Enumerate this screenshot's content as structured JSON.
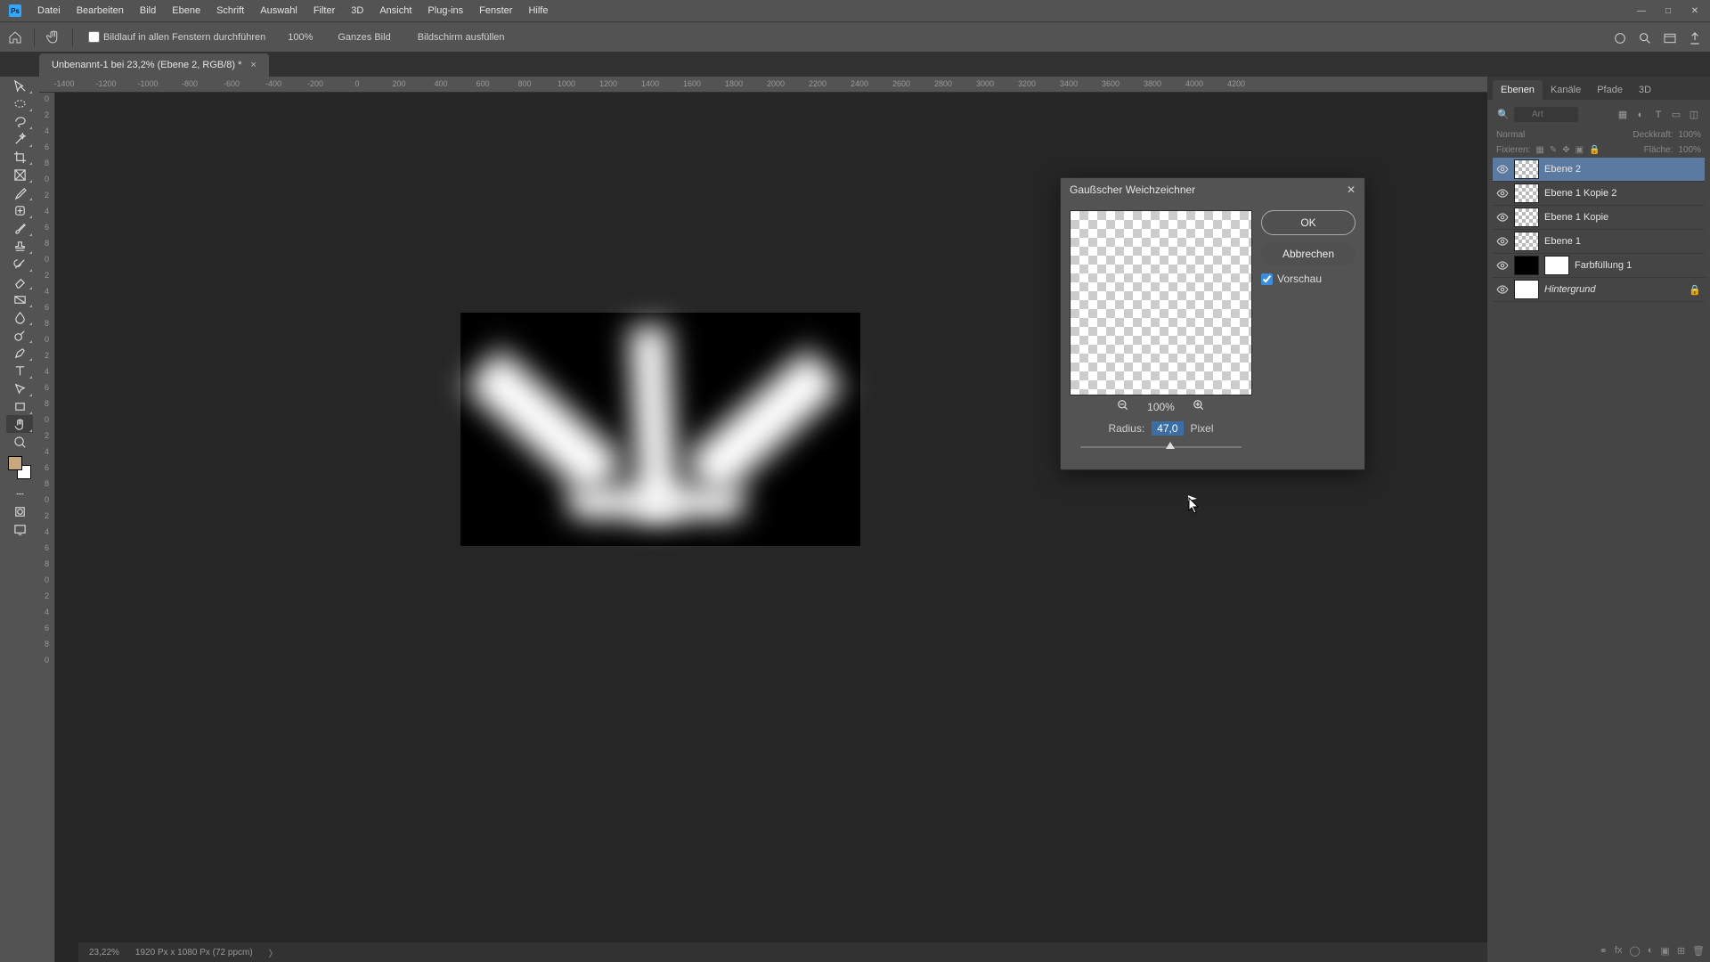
{
  "menubar": {
    "items": [
      "Datei",
      "Bearbeiten",
      "Bild",
      "Ebene",
      "Schrift",
      "Auswahl",
      "Filter",
      "3D",
      "Ansicht",
      "Plug-ins",
      "Fenster",
      "Hilfe"
    ]
  },
  "options": {
    "scroll_all": "Bildlauf in allen Fenstern durchführen",
    "zoom_pct": "100%",
    "fit_whole": "Ganzes Bild",
    "fill_screen": "Bildschirm ausfüllen"
  },
  "tab": {
    "title": "Unbenannt-1 bei 23,2% (Ebene 2, RGB/8) *"
  },
  "ruler": {
    "marks": [
      "-1400",
      "-1200",
      "-1000",
      "-800",
      "-600",
      "-400",
      "-200",
      "0",
      "200",
      "400",
      "600",
      "800",
      "1000",
      "1200",
      "1400",
      "1600",
      "1800",
      "2000",
      "2200",
      "2400",
      "2600",
      "2800",
      "3000",
      "3200",
      "3400",
      "3600",
      "3800",
      "4000",
      "4200"
    ],
    "vmarks": [
      "0",
      "2",
      "4",
      "6",
      "8",
      "0",
      "2",
      "4",
      "6",
      "8",
      "0",
      "2",
      "4",
      "6",
      "8",
      "0",
      "2",
      "4",
      "6",
      "8",
      "0",
      "2",
      "4",
      "6",
      "8",
      "0",
      "2",
      "4",
      "6",
      "8",
      "0",
      "2",
      "4",
      "6",
      "8",
      "0"
    ]
  },
  "dialog": {
    "title": "Gaußscher Weichzeichner",
    "ok": "OK",
    "cancel": "Abbrechen",
    "preview_cb": "Vorschau",
    "zoom_level": "100%",
    "radius_label": "Radius:",
    "radius_value": "47,0",
    "radius_unit": "Pixel"
  },
  "panels": {
    "tabs": [
      "Ebenen",
      "Kanäle",
      "Pfade",
      "3D"
    ],
    "search_placeholder": "Art",
    "blend_mode": "Normal",
    "opacity_label": "Deckkraft:",
    "opacity_val": "100%",
    "lock_label": "Fixieren:",
    "fill_label": "Fläche:",
    "fill_val": "100%",
    "layers": [
      {
        "name": "Ebene 2",
        "thumb": "checker",
        "sel": true
      },
      {
        "name": "Ebene 1 Kopie 2",
        "thumb": "checker"
      },
      {
        "name": "Ebene 1 Kopie",
        "thumb": "checker"
      },
      {
        "name": "Ebene 1",
        "thumb": "checker"
      },
      {
        "name": "Farbfüllung 1",
        "thumb": "black",
        "mask": true
      },
      {
        "name": "Hintergrund",
        "thumb": "white",
        "italic": true,
        "locked": true
      }
    ]
  },
  "status": {
    "zoom": "23,22%",
    "dims": "1920 Px x 1080 Px (72 ppcm)"
  },
  "tools": [
    "move",
    "marquee-ellipse",
    "lasso",
    "wand",
    "crop",
    "frame",
    "eyedropper",
    "heal",
    "brush",
    "stamp",
    "history-brush",
    "eraser",
    "gradient",
    "blur",
    "dodge",
    "pen",
    "type",
    "path-select",
    "rectangle",
    "hand",
    "zoom",
    "edit-toolbar",
    "quickmask",
    "screenmode"
  ]
}
